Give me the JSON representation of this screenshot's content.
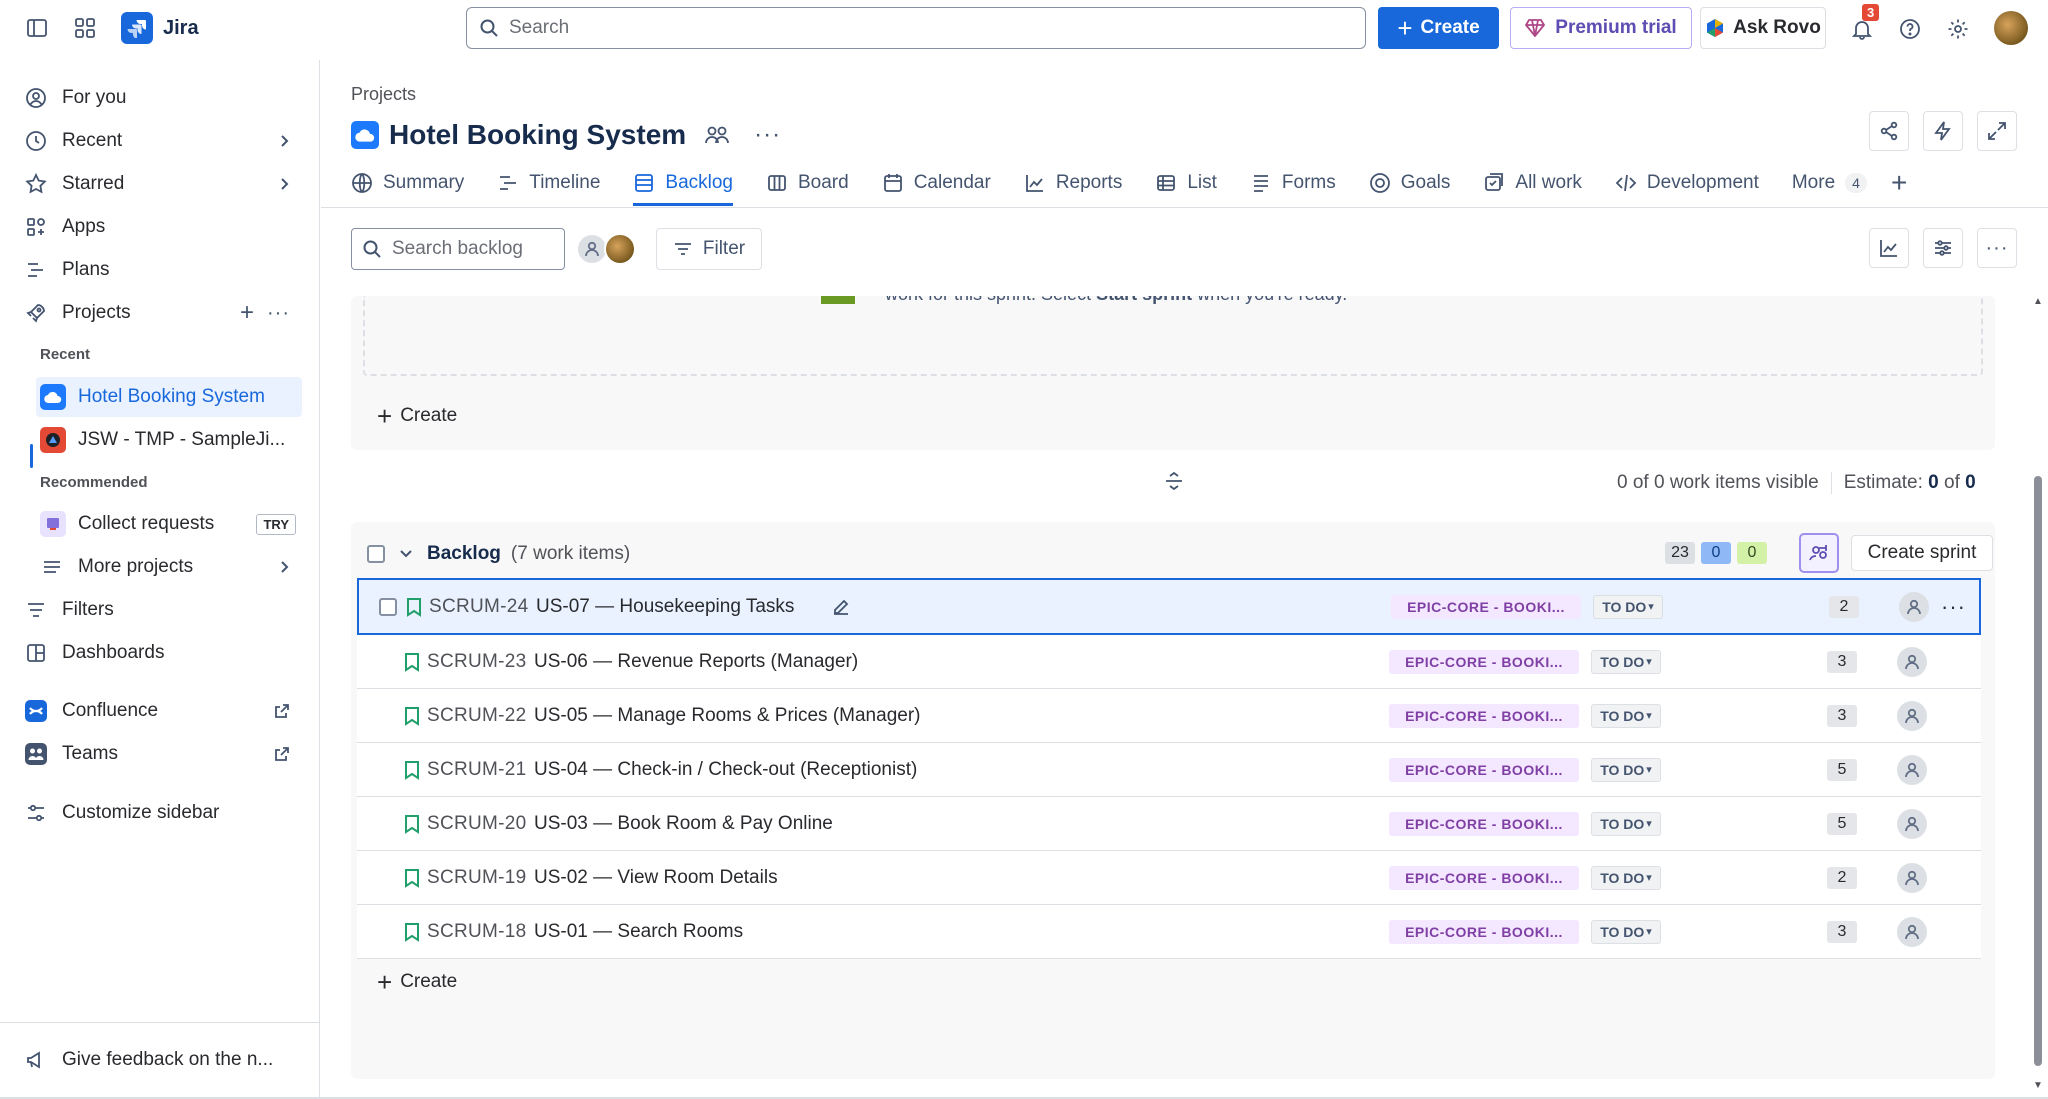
{
  "app": {
    "name": "Jira"
  },
  "search": {
    "placeholder": "Search"
  },
  "header": {
    "create_label": "Create",
    "premium_label": "Premium trial",
    "rovo_label": "Ask Rovo",
    "notification_count": "3"
  },
  "sidebar": {
    "items": [
      {
        "label": "For you",
        "icon": "user-circle-icon"
      },
      {
        "label": "Recent",
        "icon": "clock-icon"
      },
      {
        "label": "Starred",
        "icon": "star-icon"
      },
      {
        "label": "Apps",
        "icon": "apps-icon"
      },
      {
        "label": "Plans",
        "icon": "plans-icon"
      },
      {
        "label": "Projects",
        "icon": "rocket-icon"
      }
    ],
    "recent_label": "Recent",
    "recent_projects": [
      "Hotel Booking System",
      "JSW - TMP - SampleJi..."
    ],
    "recommended_label": "Recommended",
    "collect_requests": "Collect requests",
    "try_badge": "TRY",
    "more_projects": "More projects",
    "filters": "Filters",
    "dashboards": "Dashboards",
    "confluence": "Confluence",
    "teams": "Teams",
    "customize": "Customize sidebar",
    "feedback": "Give feedback on the n..."
  },
  "project": {
    "breadcrumb": "Projects",
    "title": "Hotel Booking System"
  },
  "tabs": [
    {
      "label": "Summary",
      "icon": "globe-icon"
    },
    {
      "label": "Timeline",
      "icon": "timeline-icon"
    },
    {
      "label": "Backlog",
      "icon": "backlog-icon",
      "active": true
    },
    {
      "label": "Board",
      "icon": "board-icon"
    },
    {
      "label": "Calendar",
      "icon": "calendar-icon"
    },
    {
      "label": "Reports",
      "icon": "chart-line-icon"
    },
    {
      "label": "List",
      "icon": "list-icon"
    },
    {
      "label": "Forms",
      "icon": "forms-icon"
    },
    {
      "label": "Goals",
      "icon": "goal-icon"
    },
    {
      "label": "All work",
      "icon": "all-work-icon"
    },
    {
      "label": "Development",
      "icon": "code-icon"
    }
  ],
  "more_tab": {
    "label": "More",
    "count": "4"
  },
  "toolbar": {
    "search_placeholder": "Search backlog",
    "filter_label": "Filter"
  },
  "sprint": {
    "clipped_text_pre": "work for this sprint. Select ",
    "clipped_text_bold": "Start sprint",
    "clipped_text_post": " when you're ready.",
    "create_label": "Create"
  },
  "visibility": {
    "visible_text": "0 of 0 work items visible",
    "estimate_label": "Estimate:",
    "estimate_value": "0",
    "estimate_of": "of",
    "estimate_total": "0"
  },
  "backlog": {
    "title": "Backlog",
    "count_text": "(7 work items)",
    "points_todo": "23",
    "points_inprogress": "0",
    "points_done": "0",
    "create_sprint_label": "Create sprint",
    "create_label": "Create",
    "items": [
      {
        "key": "SCRUM-24",
        "summary": "US-07 — Housekeeping Tasks",
        "epic": "EPIC-CORE - BOOKI...",
        "status": "TO DO",
        "points": "2"
      },
      {
        "key": "SCRUM-23",
        "summary": "US-06 — Revenue Reports (Manager)",
        "epic": "EPIC-CORE - BOOKI...",
        "status": "TO DO",
        "points": "3"
      },
      {
        "key": "SCRUM-22",
        "summary": "US-05 — Manage Rooms & Prices (Manager)",
        "epic": "EPIC-CORE - BOOKI...",
        "status": "TO DO",
        "points": "3"
      },
      {
        "key": "SCRUM-21",
        "summary": "US-04 — Check-in / Check-out (Receptionist)",
        "epic": "EPIC-CORE - BOOKI...",
        "status": "TO DO",
        "points": "5"
      },
      {
        "key": "SCRUM-20",
        "summary": "US-03 — Book Room & Pay Online",
        "epic": "EPIC-CORE - BOOKI...",
        "status": "TO DO",
        "points": "5"
      },
      {
        "key": "SCRUM-19",
        "summary": "US-02 — View Room Details",
        "epic": "EPIC-CORE - BOOKI...",
        "status": "TO DO",
        "points": "2"
      },
      {
        "key": "SCRUM-18",
        "summary": "US-01 — Search Rooms",
        "epic": "EPIC-CORE - BOOKI...",
        "status": "TO DO",
        "points": "3"
      }
    ]
  },
  "colors": {
    "brand": "#1868db",
    "epic_bg": "#f3e8ff",
    "epic_text": "#803fa5",
    "story_green": "#22a06b",
    "notification": "#e34935"
  }
}
